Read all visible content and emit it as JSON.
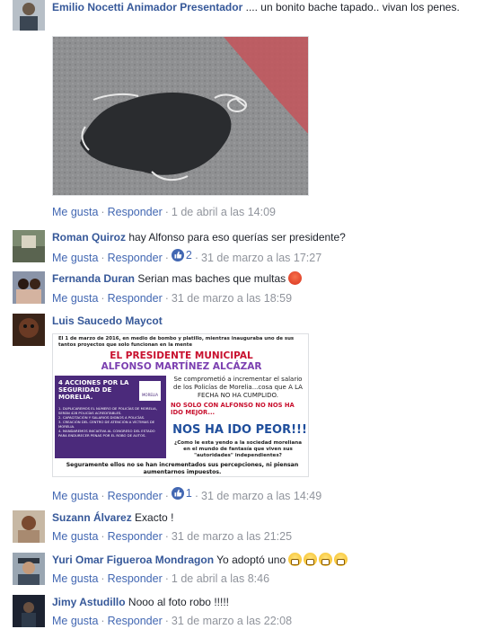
{
  "actions": {
    "like": "Me gusta",
    "reply": "Responder"
  },
  "comments": [
    {
      "author": "Emilio Nocetti Animador Presentador",
      "text": ".... un bonito bache tapado.. vivan los penes.",
      "timestamp": "1 de abril a las 14:09",
      "avatar_icon": "profile-photo"
    },
    {
      "author": "Roman Quiroz",
      "text": "hay Alfonso para eso querías ser presidente?",
      "likes": "2",
      "timestamp": "31 de marzo a las 17:27",
      "avatar_icon": "profile-photo"
    },
    {
      "author": "Fernanda Duran",
      "text": "Serian mas baches que multas",
      "emoji": "angry-face",
      "timestamp": "31 de marzo a las 18:59",
      "avatar_icon": "profile-photo"
    },
    {
      "author": "Luis Saucedo Maycot",
      "text": "",
      "likes": "1",
      "timestamp": "31 de marzo a las 14:49",
      "avatar_icon": "profile-photo"
    },
    {
      "author": "Suzann Álvarez",
      "text": "Exacto !",
      "timestamp": "31 de marzo a las 21:25",
      "avatar_icon": "profile-photo"
    },
    {
      "author": "Yuri Omar Figueroa Mondragon",
      "text": "Yo adoptó uno",
      "emoji": "grinning-face x4",
      "timestamp": "1 de abril a las 8:46",
      "avatar_icon": "profile-photo"
    },
    {
      "author": "Jimy Astudillo",
      "text": "Nooo al foto robo !!!!!",
      "timestamp": "31 de marzo a las 22:08",
      "avatar_icon": "profile-photo"
    }
  ],
  "poster": {
    "intro": "El 1 de marzo de 2016, en medio de bombo y platillo, mientras inauguraba uno de sus tantos proyectos que solo funcionan en la mente",
    "heading1": "EL PRESIDENTE MUNICIPAL",
    "heading2": "ALFONSO MARTÍNEZ ALCÁZAR",
    "promise": "Se comprometió a incrementar el salario de los Policías de Morelia...cosa que A LA FECHA NO HA CUMPLIDO.",
    "not_only": "NO SOLO CON ALFONSO NO NOS HA IDO MEJOR...",
    "worse": "NOS HA IDO PEOR!!!",
    "question": "¿Como le esta yendo a la sociedad moreliana en el mundo de fantasía que viven sus \"autoridades\" independientes?",
    "footer": "Seguramente ellos no se han incrementados sus percepciones, ni piensan aumentarnos impuestos.",
    "box_title": "4 ACCIONES POR LA SEGURIDAD DE MORELIA.",
    "box_logo": "MORELIA",
    "box_items": [
      "1. DUPLICAREMOS EL NÚMERO DE POLICÍAS DE MORELIA, SERÁN 428 POLICÍAS ACREDITABLES.",
      "2. CAPACITACIÓN Y SALARIOS DIGNOS A POLICÍAS.",
      "3. CREACIÓN DEL CENTRO DE ATENCIÓN A VÍCTIMAS DE MORELIA.",
      "4. MANDAREMOS INICIATIVA AL CONGRESO DEL ESTADO PARA ENDURECER PENAS POR EL ROBO DE AUTOS."
    ]
  },
  "colors": {
    "link": "#365899",
    "action": "#4267b2",
    "meta": "#90949c",
    "poster_red": "#c8102e",
    "poster_purple": "#4b2a7b",
    "poster_blue": "#1f4e9c"
  }
}
